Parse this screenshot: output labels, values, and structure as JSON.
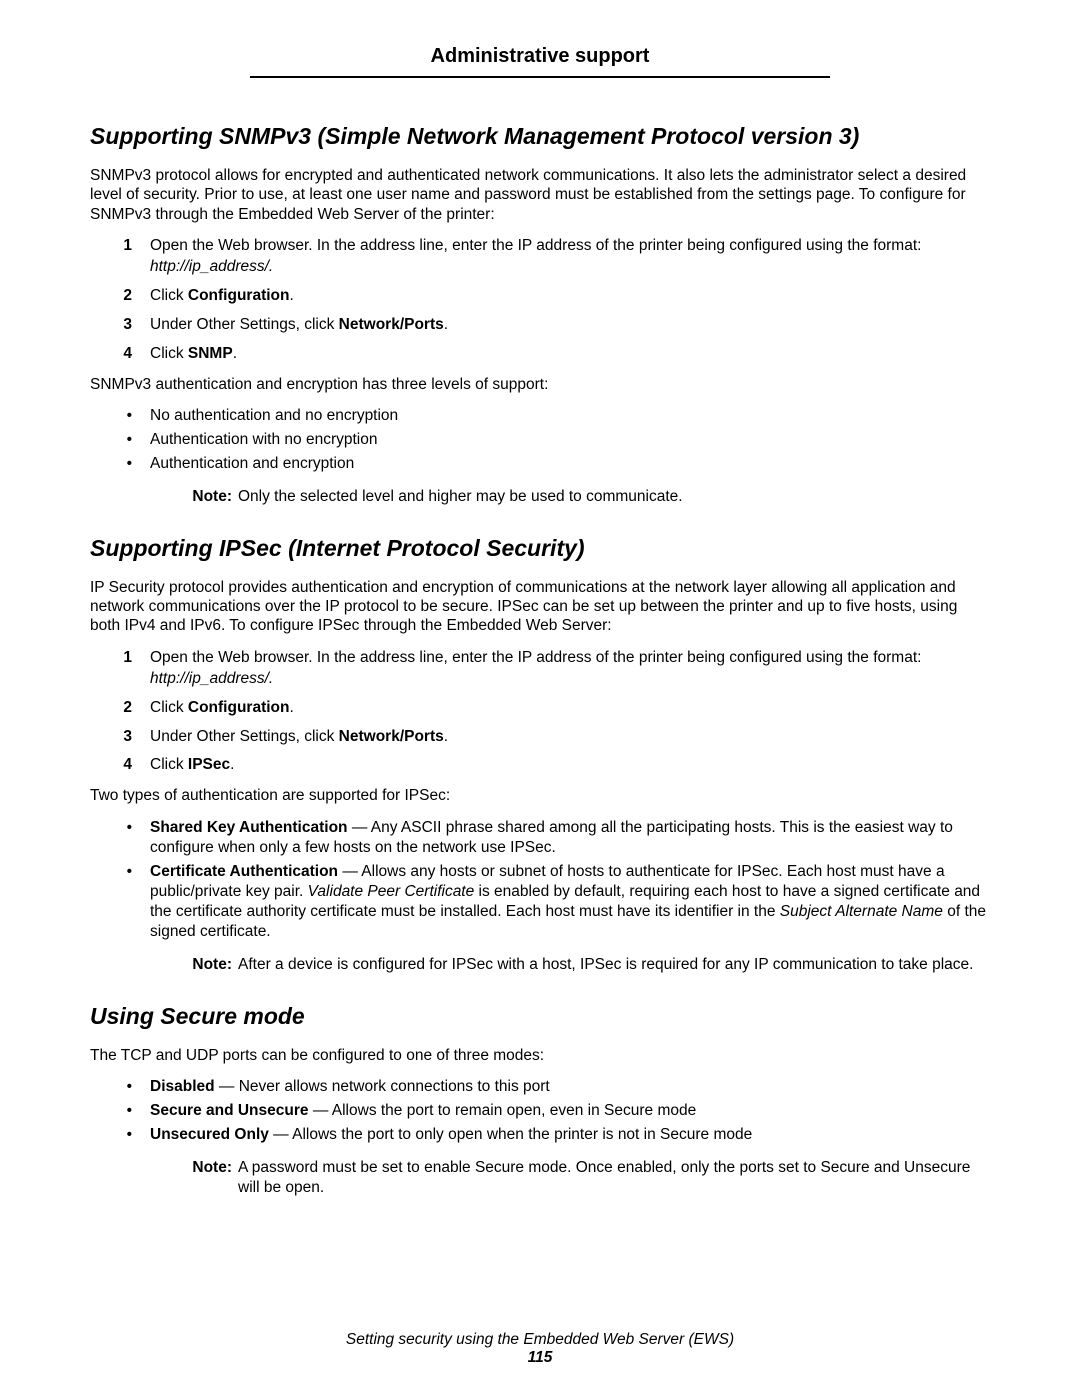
{
  "header": "Administrative support",
  "s1": {
    "title": "Supporting SNMPv3 (Simple Network Management Protocol version 3)",
    "intro": "SNMPv3 protocol allows for encrypted and authenticated network communications. It also lets the administrator select a desired level of security. Prior to use, at least one user name and password must be established from the settings page. To configure for SNMPv3 through the Embedded Web Server of the printer:",
    "steps": {
      "s1a": "Open the Web browser. In the address line, enter the IP address of the printer being configured using the format: ",
      "s1b": "http://ip_address/.",
      "s2a": "Click ",
      "s2b": "Configuration",
      "s3a": "Under Other Settings, click ",
      "s3b": "Network/Ports",
      "s4a": "Click ",
      "s4b": "SNMP"
    },
    "mid": "SNMPv3 authentication and encryption has three levels of support:",
    "bullets": {
      "b1": "No authentication and no encryption",
      "b2": "Authentication with no encryption",
      "b3": "Authentication and encryption"
    },
    "noteLabel": "Note:",
    "note": "Only the selected level and higher may be used to communicate."
  },
  "s2": {
    "title": "Supporting IPSec (Internet Protocol Security)",
    "intro": "IP Security protocol provides authentication and encryption of communications at the network layer allowing all application and network communications over the IP protocol to be secure. IPSec can be set up between the printer and up to five hosts, using both IPv4 and IPv6. To configure IPSec through the Embedded Web Server:",
    "steps": {
      "s1a": "Open the Web browser. In the address line, enter the IP address of the printer being configured using the format: ",
      "s1b": "http://ip_address/.",
      "s2a": "Click ",
      "s2b": "Configuration",
      "s3a": "Under Other Settings, click ",
      "s3b": "Network/Ports",
      "s4a": "Click ",
      "s4b": "IPSec"
    },
    "mid": "Two types of authentication are supported for IPSec:",
    "bullets": {
      "b1a": "Shared Key Authentication",
      "b1b": " — Any ASCII phrase shared among all the participating hosts. This is the easiest way to configure when only a few hosts on the network use IPSec.",
      "b2a": "Certificate Authentication",
      "b2b": " — Allows any hosts or subnet of hosts to authenticate for IPSec. Each host must have a public/private key pair. ",
      "b2c": "Validate Peer Certificate",
      "b2d": " is enabled by default, requiring each host to have a signed certificate and the certificate authority certificate must be installed. Each host must have its identifier in the ",
      "b2e": "Subject Alternate Name",
      "b2f": " of the signed certificate."
    },
    "noteLabel": "Note:",
    "note": "After a device is configured for IPSec with a host, IPSec is required for any IP communication to take place."
  },
  "s3": {
    "title": "Using Secure mode",
    "intro": "The TCP and UDP ports can be configured to one of three modes:",
    "bullets": {
      "b1a": "Disabled",
      "b1b": " — Never allows network connections to this port",
      "b2a": "Secure and Unsecure",
      "b2b": " — Allows the port to remain open, even in Secure mode",
      "b3a": "Unsecured Only",
      "b3b": " — Allows the port to only open when the printer is not in Secure mode"
    },
    "noteLabel": "Note:",
    "note": "A password must be set to enable Secure mode. Once enabled, only the ports set to Secure and Unsecure will be open."
  },
  "footer": {
    "text": "Setting security using the Embedded Web Server (EWS)",
    "page": "115"
  }
}
